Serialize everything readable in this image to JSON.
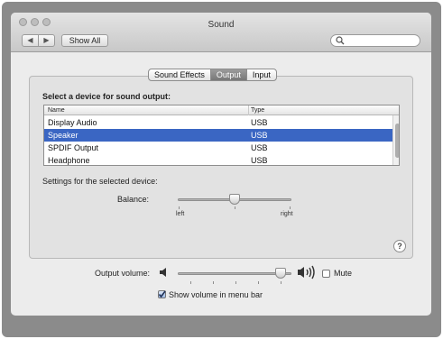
{
  "window": {
    "title": "Sound",
    "show_all_label": "Show All",
    "nav_back": "◀",
    "nav_forward": "▶"
  },
  "search": {
    "placeholder": "",
    "icon": "search-icon"
  },
  "tabs": [
    {
      "label": "Sound Effects",
      "selected": false
    },
    {
      "label": "Output",
      "selected": true
    },
    {
      "label": "Input",
      "selected": false
    }
  ],
  "output": {
    "heading": "Select a device for sound output:",
    "columns": [
      "Name",
      "Type"
    ],
    "devices": [
      {
        "name": "Display Audio",
        "type": "USB",
        "selected": false
      },
      {
        "name": "Speaker",
        "type": "USB",
        "selected": true
      },
      {
        "name": "SPDIF Output",
        "type": "USB",
        "selected": false
      },
      {
        "name": "Headphone",
        "type": "USB",
        "selected": false
      }
    ],
    "settings_label": "Settings for the selected device:",
    "balance": {
      "label": "Balance:",
      "left": "left",
      "right": "right",
      "value": 0.5
    }
  },
  "help_label": "?",
  "volume": {
    "label": "Output volume:",
    "value": 0.95,
    "mute_label": "Mute",
    "mute_checked": false,
    "show_in_menu_label": "Show volume in menu bar",
    "show_in_menu_checked": true
  },
  "colors": {
    "selection": "#3a66c3",
    "window_bg": "#ececec"
  }
}
